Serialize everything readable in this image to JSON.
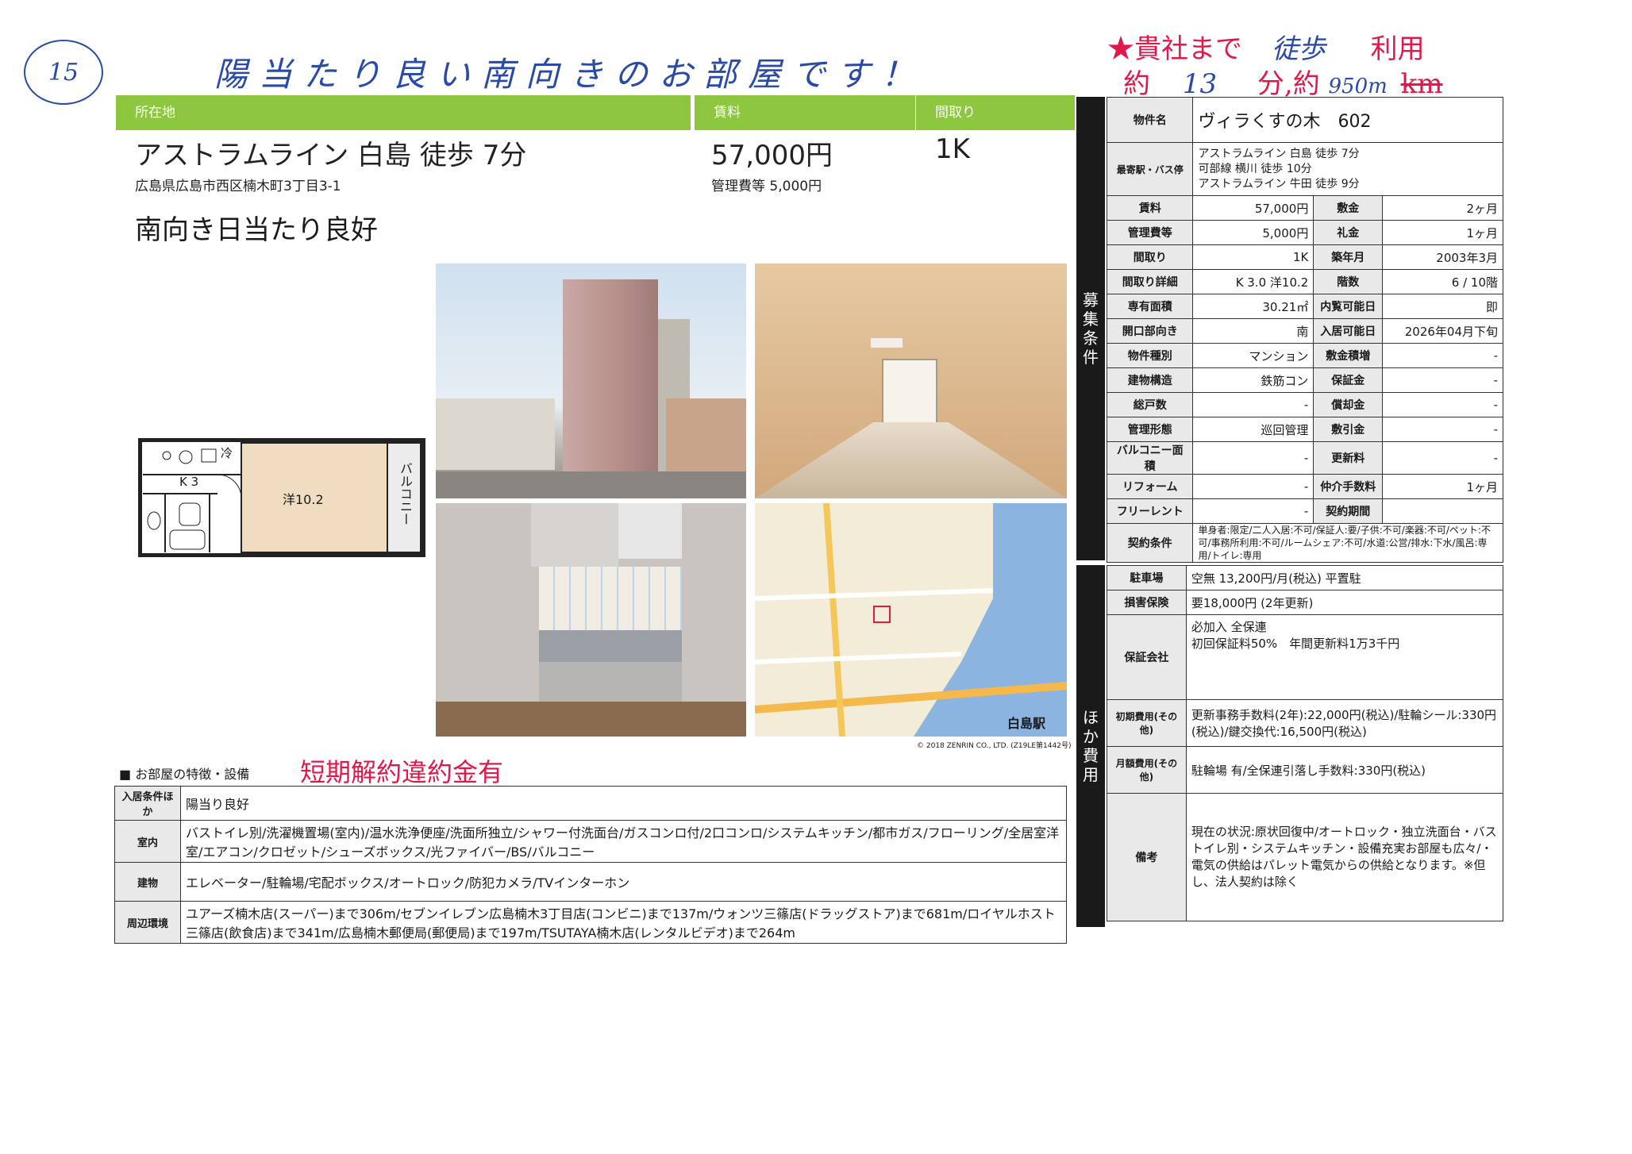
{
  "handwritten": {
    "circle_number": "15",
    "headline": "陽当たり良い南向きのお部屋です！",
    "top_right_line1_prefix": "★貴社まで",
    "top_right_line1_mode": "徒歩",
    "top_right_line1_suffix": "利用",
    "top_right_line2_a": "約",
    "top_right_line2_minutes": "13",
    "top_right_line2_b": "分,約",
    "top_right_line2_distance": "950m",
    "top_right_line2_unit": "km",
    "penalty_note": "短期解約違約金有"
  },
  "header": {
    "location_label": "所在地",
    "rent_label": "賃料",
    "layout_label": "間取り",
    "access": "アストラムライン 白島 徒歩 7分",
    "address": "広島県広島市西区楠木町3丁目3-1",
    "rent": "57,000円",
    "mgmt_fee": "管理費等 5,000円",
    "layout": "1K",
    "catch": "南向き日当たり良好"
  },
  "floorplan": {
    "kitchen": "K 3",
    "room": "洋10.2",
    "balcony": "バルコニー",
    "fridge": "冷"
  },
  "map": {
    "station": "白島駅",
    "copyright": "© 2018 ZENRIN CO., LTD. (Z19LE第1442号)"
  },
  "specs": {
    "sidebar1": [
      "募",
      "集",
      "条",
      "件"
    ],
    "sidebar2": [
      "ほ",
      "か",
      "費",
      "用"
    ],
    "property_name_label": "物件名",
    "property_name": "ヴィラくすの木　602",
    "station_label": "最寄駅・バス停",
    "station_lines": [
      "アストラムライン 白島 徒歩 7分",
      "可部線 横川 徒歩 10分",
      "アストラムライン 牛田 徒歩 9分"
    ],
    "rows": [
      {
        "l1": "賃料",
        "v1": "57,000円",
        "l2": "敷金",
        "v2": "2ヶ月"
      },
      {
        "l1": "管理費等",
        "v1": "5,000円",
        "l2": "礼金",
        "v2": "1ヶ月"
      },
      {
        "l1": "間取り",
        "v1": "1K",
        "l2": "築年月",
        "v2": "2003年3月"
      },
      {
        "l1": "間取り詳細",
        "v1": "K 3.0 洋10.2",
        "l2": "階数",
        "v2": "6 / 10階"
      },
      {
        "l1": "専有面積",
        "v1": "30.21㎡",
        "l2": "内覧可能日",
        "v2": "即"
      },
      {
        "l1": "開口部向き",
        "v1": "南",
        "l2": "入居可能日",
        "v2": "2026年04月下旬"
      },
      {
        "l1": "物件種別",
        "v1": "マンション",
        "l2": "敷金積増",
        "v2": "-"
      },
      {
        "l1": "建物構造",
        "v1": "鉄筋コン",
        "l2": "保証金",
        "v2": "-"
      },
      {
        "l1": "総戸数",
        "v1": "-",
        "l2": "償却金",
        "v2": "-"
      },
      {
        "l1": "管理形態",
        "v1": "巡回管理",
        "l2": "敷引金",
        "v2": "-"
      },
      {
        "l1": "バルコニー面積",
        "v1": "-",
        "l2": "更新料",
        "v2": "-"
      },
      {
        "l1": "リフォーム",
        "v1": "-",
        "l2": "仲介手数料",
        "v2": "1ヶ月"
      },
      {
        "l1": "フリーレント",
        "v1": "-",
        "l2": "契約期間",
        "v2": ""
      }
    ],
    "contract_label": "契約条件",
    "contract": "単身者:限定/二人入居:不可/保証人:要/子供:不可/楽器:不可/ペット:不可/事務所利用:不可/ルームシェア:不可/水道:公営/排水:下水/風呂:専用/トイレ:専用",
    "parking_label": "駐車場",
    "parking": "空無 13,200円/月(税込) 平置駐",
    "insurance_label": "損害保険",
    "insurance": "要18,000円 (2年更新)",
    "guarantor_label": "保証会社",
    "guarantor": [
      "必加入 全保連",
      "初回保証料50%　年間更新料1万3千円"
    ],
    "initial_label": "初期費用(その他)",
    "initial": "更新事務手数料(2年):22,000円(税込)/駐輪シール:330円(税込)/鍵交換代:16,500円(税込)",
    "monthly_label": "月額費用(その他)",
    "monthly": "駐輪場 有/全保連引落し手数料:330円(税込)",
    "remarks_label": "備考",
    "remarks": "現在の状況:原状回復中/オートロック・独立洗面台・バストイレ別・システムキッチン・設備充実お部屋も広々/・電気の供給はパレット電気からの供給となります。※但し、法人契約は除く"
  },
  "features": {
    "heading": "■ お部屋の特徴・設備",
    "rows": [
      {
        "label": "入居条件ほか",
        "value": "陽当り良好"
      },
      {
        "label": "室内",
        "value": "バストイレ別/洗濯機置場(室内)/温水洗浄便座/洗面所独立/シャワー付洗面台/ガスコンロ付/2口コンロ/システムキッチン/都市ガス/フローリング/全居室洋室/エアコン/クロゼット/シューズボックス/光ファイバー/BS/バルコニー"
      },
      {
        "label": "建物",
        "value": "エレベーター/駐輪場/宅配ボックス/オートロック/防犯カメラ/TVインターホン"
      },
      {
        "label": "周辺環境",
        "value": "ユアーズ楠木店(スーパー)まで306m/セブンイレブン広島楠木3丁目店(コンビニ)まで137m/ウォンツ三篠店(ドラッグストア)まで681m/ロイヤルホスト三篠店(飲食店)まで341m/広島楠木郵便局(郵便局)まで197m/TSUTAYA楠木店(レンタルビデオ)まで264m"
      }
    ]
  }
}
